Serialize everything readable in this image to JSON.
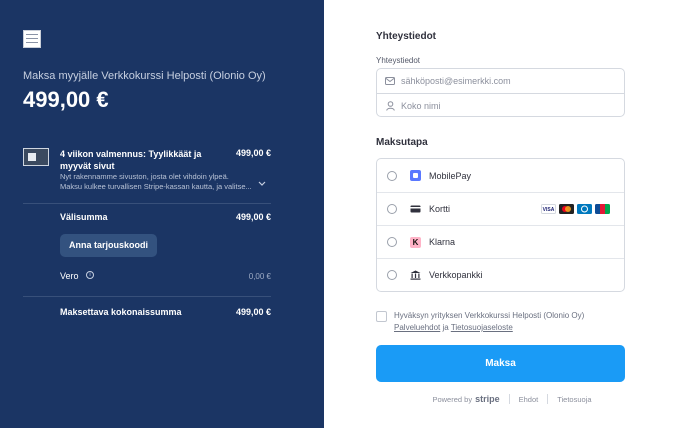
{
  "summary": {
    "merchant_line": "Maksa myyjälle Verkkokurssi Helposti (Olonio Oy)",
    "amount": "499,00 €",
    "product": {
      "name": "4 viikon valmennus: Tyylikkäät ja myyvät sivut",
      "price": "499,00 €",
      "description_line1": "Nyt rakennamme sivuston, josta olet vihdoin ylpeä.",
      "description_line2": "Maksu kulkee turvallisen Stripe-kassan kautta, ja valitse..."
    },
    "subtotal_label": "Välisumma",
    "subtotal_value": "499,00 €",
    "promo_label": "Anna tarjouskoodi",
    "tax_label": "Vero",
    "tax_value": "0,00 €",
    "total_label": "Maksettava kokonaissumma",
    "total_value": "499,00 €"
  },
  "contact": {
    "heading": "Yhteystiedot",
    "email_label": "Yhteystiedot",
    "email_placeholder": "sähköposti@esimerkki.com",
    "name_placeholder": "Koko nimi"
  },
  "payment": {
    "heading": "Maksutapa",
    "methods": [
      {
        "label": "MobilePay",
        "icon": "mobilepay-icon"
      },
      {
        "label": "Kortti",
        "icon": "card-icon"
      },
      {
        "label": "Klarna",
        "icon": "klarna-icon"
      },
      {
        "label": "Verkkopankki",
        "icon": "bank-icon"
      }
    ],
    "card_brands": [
      "VISA",
      "Mastercard",
      "Diners",
      "JCB"
    ]
  },
  "terms": {
    "prefix": "Hyväksyn yrityksen Verkkokurssi Helposti (Olonio Oy)",
    "link_terms": "Palveluehdot",
    "joiner": "ja",
    "link_privacy": "Tietosuojaseloste"
  },
  "pay_button_label": "Maksa",
  "footer": {
    "powered_by": "Powered by",
    "brand": "stripe",
    "terms": "Ehdot",
    "privacy": "Tietosuoja"
  },
  "colors": {
    "left_bg": "#1b3564",
    "pay_button": "#1a9bf6",
    "mobilepay": "#5a78ff",
    "klarna": "#ffb3c7"
  }
}
